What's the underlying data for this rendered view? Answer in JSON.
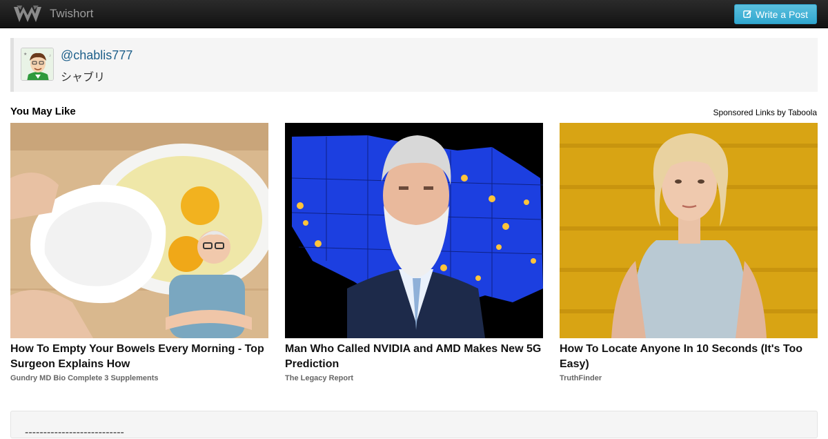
{
  "navbar": {
    "brand_name": "Twishort",
    "write_button_label": "Write a Post"
  },
  "profile": {
    "handle": "@chablis777",
    "display_name": "シャブリ"
  },
  "recommendations": {
    "title": "You May Like",
    "sponsored_label": "Sponsored Links by Taboola",
    "items": [
      {
        "headline": "How To Empty Your Bowels Every Morning - Top Surgeon Explains How",
        "source": "Gundry MD Bio Complete 3 Supplements"
      },
      {
        "headline": "Man Who Called NVIDIA and AMD Makes New 5G Prediction",
        "source": "The Legacy Report"
      },
      {
        "headline": "How To Locate Anyone In 10 Seconds (It's Too Easy)",
        "source": "TruthFinder"
      }
    ]
  },
  "post": {
    "text": "---------------------------"
  },
  "colors": {
    "navbar_bg": "#1b1b1b",
    "button_bg": "#5bc0de",
    "handle_link": "#1d5f8a",
    "panel_bg": "#f5f5f5"
  },
  "icons": [
    "twishort-logo-icon",
    "edit-icon"
  ]
}
